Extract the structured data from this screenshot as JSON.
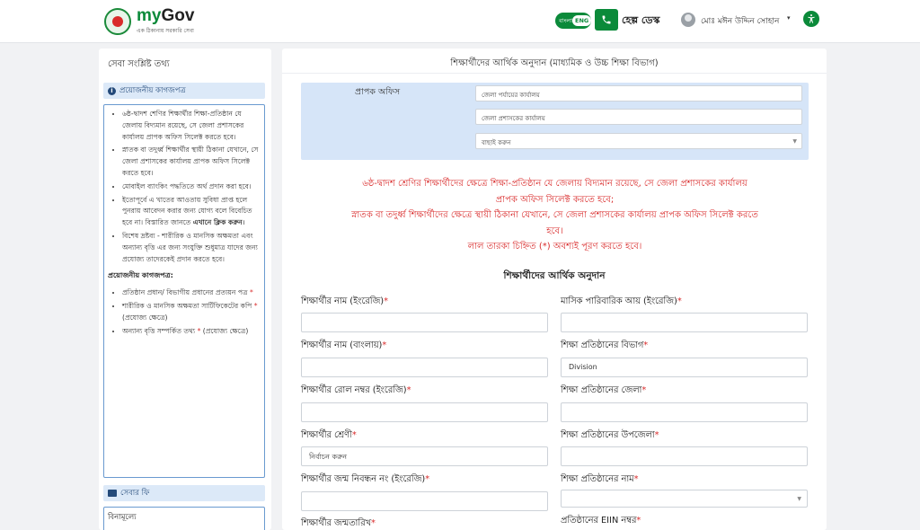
{
  "header": {
    "logo_title_my": "my",
    "logo_title_gov": "Gov",
    "logo_subtitle": "এক ঠিকানায় সরকারি সেবা",
    "lang_bn": "বাংলা",
    "lang_en": "ENG",
    "help_desk": "হেল্প ডেস্ক",
    "user_name": "মোঃ মঈন উদ্দিন সোহান",
    "user_caret": "▾",
    "accessibility_icon": "accessibility-icon",
    "phone_icon": "phone-icon",
    "brand_color": "#0b8a3a"
  },
  "sidebar": {
    "title": "সেবা সংশ্লিষ্ট তথ্য",
    "docs_heading": "প্রয়োজনীয় কাগজপত্র",
    "notes": [
      "৬ষ্ঠ-দ্বাদশ শেণির শিক্ষার্থীর শিক্ষা-প্রতিষ্ঠান যে জেলায় বিদ্যমান রয়েছে, সে জেলা প্রশাসকের কার্যালয় প্রাপক অফিস সিলেক্ট করতে হবে।",
      "স্নাতক বা তদুর্ধ্ব শিক্ষার্থীর স্থায়ী ঠিকানা যেখানে, সে জেলা প্রশাসকের কার্যালয় প্রাপক অফিস সিলেক্ট করতে হবে।",
      "মোবাইল ব্যাংকিং পদ্ধতিতে অর্থ প্রদান করা হবে।",
      "ইতোপূর্বে এ খাতের আওতায় সুবিধা প্রাপ্ত হলে পুনরায় আবেদন করার জন্য যোগ্য বলে বিবেচিত হবে না। বিস্তারিত জানতে",
      "বিশেষ দ্রষ্টব্য - শারীরিক ও মানসিক অক্ষমতা এবং অন্যান্য বৃত্তি এর জন্য সংযুক্তি শুধুমাত্র যাদের জন্য প্রযোজ্য তাদেরকেই প্রদান করতে হবে।"
    ],
    "notes_link": "এখানে ক্লিক করুন",
    "required_title": "প্রয়োজনীয় কাগজপত্র:",
    "required_docs": [
      {
        "text": "প্রতিষ্ঠান প্রধান/ বিভাগীয় প্রধানের প্রত্যয়ন পত্র",
        "suffix": ""
      },
      {
        "text": "শারীরিক ও মানসিক অক্ষমতা সার্টিফিকেটের কপি",
        "suffix": "(প্রযোজ্য ক্ষেত্রে)"
      },
      {
        "text": "অন্যান্য বৃত্তি সম্পর্কিত তথ্য",
        "suffix": "(প্রযোজ্য ক্ষেত্রে)"
      }
    ],
    "required_star": "*",
    "fee_heading": "সেবার ফি",
    "fee_value": "বিনামূল্যে"
  },
  "main": {
    "title": "শিক্ষার্থীদের আর্থিক অনুদান (মাধ্যমিক ও উচ্চ শিক্ষা বিভাগ)",
    "office_label": "প্রাপক অফিস",
    "office_level": "জেলা পর্যায়ের কার্যালয়",
    "office_type": "জেলা প্রশাসকের কার্যালয়",
    "office_select_placeholder": "বাছাই করুন",
    "notice_lines": [
      "৬ষ্ঠ-দ্বাদশ শ্রেণির শিক্ষার্থীদের ক্ষেত্রে শিক্ষা-প্রতিষ্ঠান যে জেলায় বিদ্যমান রয়েছে, সে জেলা প্রশাসকের কার্যালয়",
      "প্রাপক অফিস সিলেক্ট করতে হবে;",
      "স্নাতক বা তদুর্ধ্ব শিক্ষার্থীদের ক্ষেত্রে স্থায়ী ঠিকানা যেখানে, সে জেলা প্রশাসকের কার্যালয় প্রাপক অফিস সিলেক্ট করতে",
      "হবে।",
      "লাল তারকা চিহ্নিত (*) অবশ্যই পূরণ করতে হবে।"
    ],
    "section_heading": "শিক্ষার্থীদের আর্থিক অনুদান",
    "required_star": "*",
    "left_fields": [
      {
        "label": "শিক্ষার্থীর নাম (ইংরেজি)",
        "value": ""
      },
      {
        "label": "শিক্ষার্থীর নাম (বাংলায়)",
        "value": ""
      },
      {
        "label": "শিক্ষার্থীর রোল নম্বর (ইংরেজি)",
        "value": ""
      },
      {
        "label": "শিক্ষার্থীর শ্রেণী",
        "value": "নির্বাচন করুন"
      },
      {
        "label": "শিক্ষার্থীর জন্ম নিবন্ধন নং (ইংরেজি)",
        "value": ""
      },
      {
        "label": "শিক্ষার্থীর জন্মতারিখ"
      }
    ],
    "right_fields": [
      {
        "label": "মাসিক পারিবারিক আয় (ইংরেজি)",
        "value": ""
      },
      {
        "label": "শিক্ষা প্রতিষ্ঠানের বিভাগ",
        "value": "Division"
      },
      {
        "label": "শিক্ষা প্রতিষ্ঠানের জেলা",
        "value": ""
      },
      {
        "label": "শিক্ষা প্রতিষ্ঠানের উপজেলা",
        "value": ""
      },
      {
        "label": "শিক্ষা প্রতিষ্ঠানের নাম",
        "value": ""
      },
      {
        "label": "প্রতিষ্ঠানের EIIN নম্বর"
      }
    ],
    "alert_color": "#d92b2b"
  }
}
